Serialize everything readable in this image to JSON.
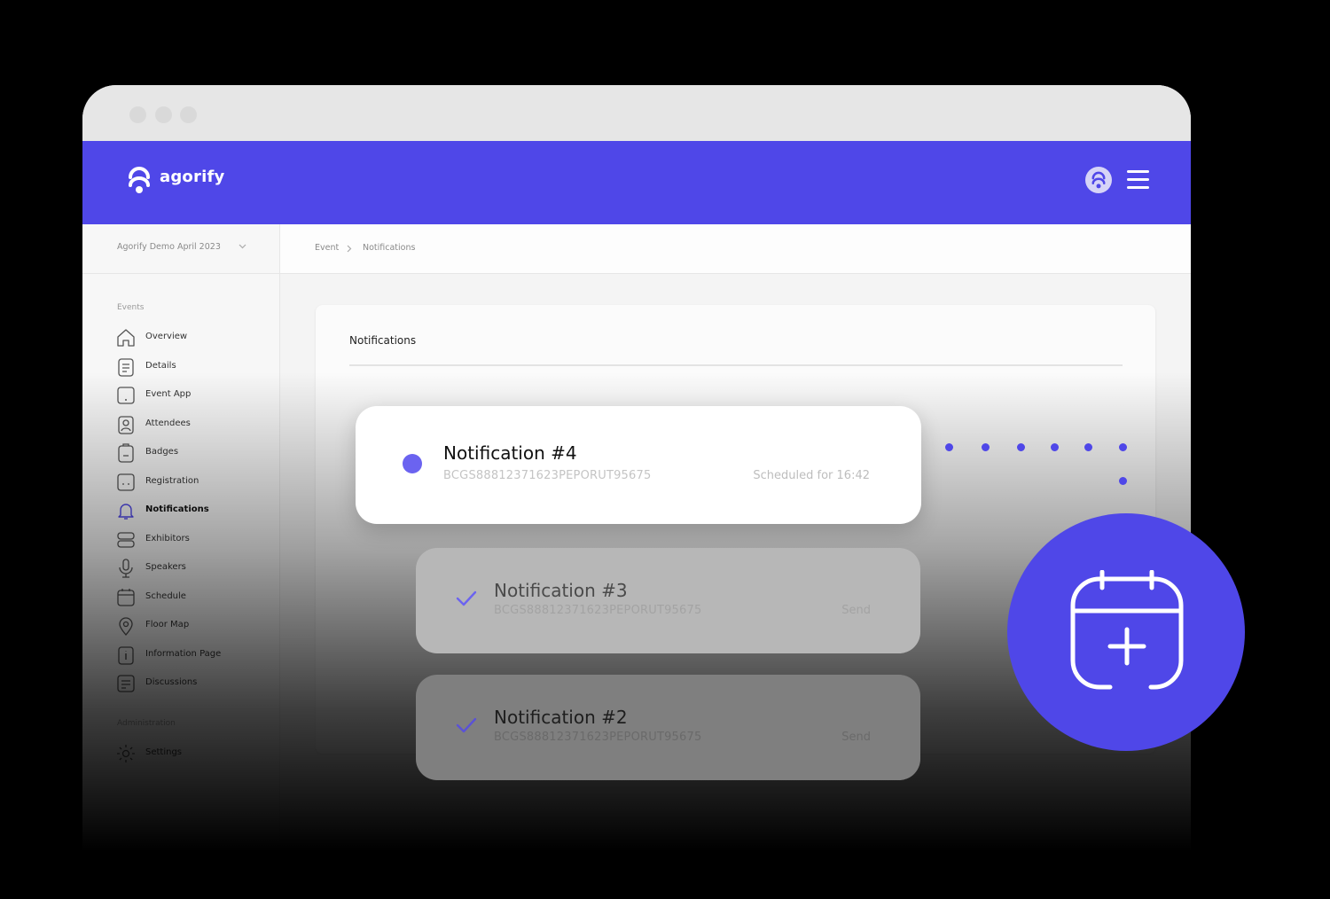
{
  "app": {
    "brand": "agorify",
    "brand_color": "#4f47e8"
  },
  "event_selector": {
    "value": "Agorify Demo April 2023"
  },
  "breadcrumb": [
    "Event",
    "Notifications"
  ],
  "sidebar": {
    "section_events": "Events",
    "items": [
      {
        "label": "Overview",
        "icon": "home-icon"
      },
      {
        "label": "Details",
        "icon": "document-icon"
      },
      {
        "label": "Event App",
        "icon": "tablet-icon"
      },
      {
        "label": "Attendees",
        "icon": "user-badge-icon"
      },
      {
        "label": "Badges",
        "icon": "badge-icon"
      },
      {
        "label": "Registration",
        "icon": "registration-icon"
      },
      {
        "label": "Notifications",
        "icon": "bell-icon",
        "active": true
      },
      {
        "label": "Exhibitors",
        "icon": "stack-icon"
      },
      {
        "label": "Speakers",
        "icon": "microphone-icon"
      },
      {
        "label": "Schedule",
        "icon": "calendar-icon"
      },
      {
        "label": "Floor Map",
        "icon": "map-pin-icon"
      },
      {
        "label": "Information Page",
        "icon": "info-page-icon"
      },
      {
        "label": "Discussions",
        "icon": "chat-icon"
      }
    ],
    "section_admin": "Administration",
    "admin_items": [
      {
        "label": "Settings",
        "icon": "gear-icon"
      }
    ]
  },
  "panel": {
    "title": "Notifications"
  },
  "notifications": [
    {
      "title": "Notification #4",
      "code": "BCGS88812371623PEPORUT95675",
      "status": "Scheduled for 16:42",
      "state": "scheduled"
    },
    {
      "title": "Notification #3",
      "code": "BCGS88812371623PEPORUT95675",
      "status": "Send",
      "state": "sent"
    },
    {
      "title": "Notification #2",
      "code": "BCGS88812371623PEPORUT95675",
      "status": "Send",
      "state": "sent"
    }
  ],
  "fab": {
    "icon": "calendar-add-icon"
  }
}
